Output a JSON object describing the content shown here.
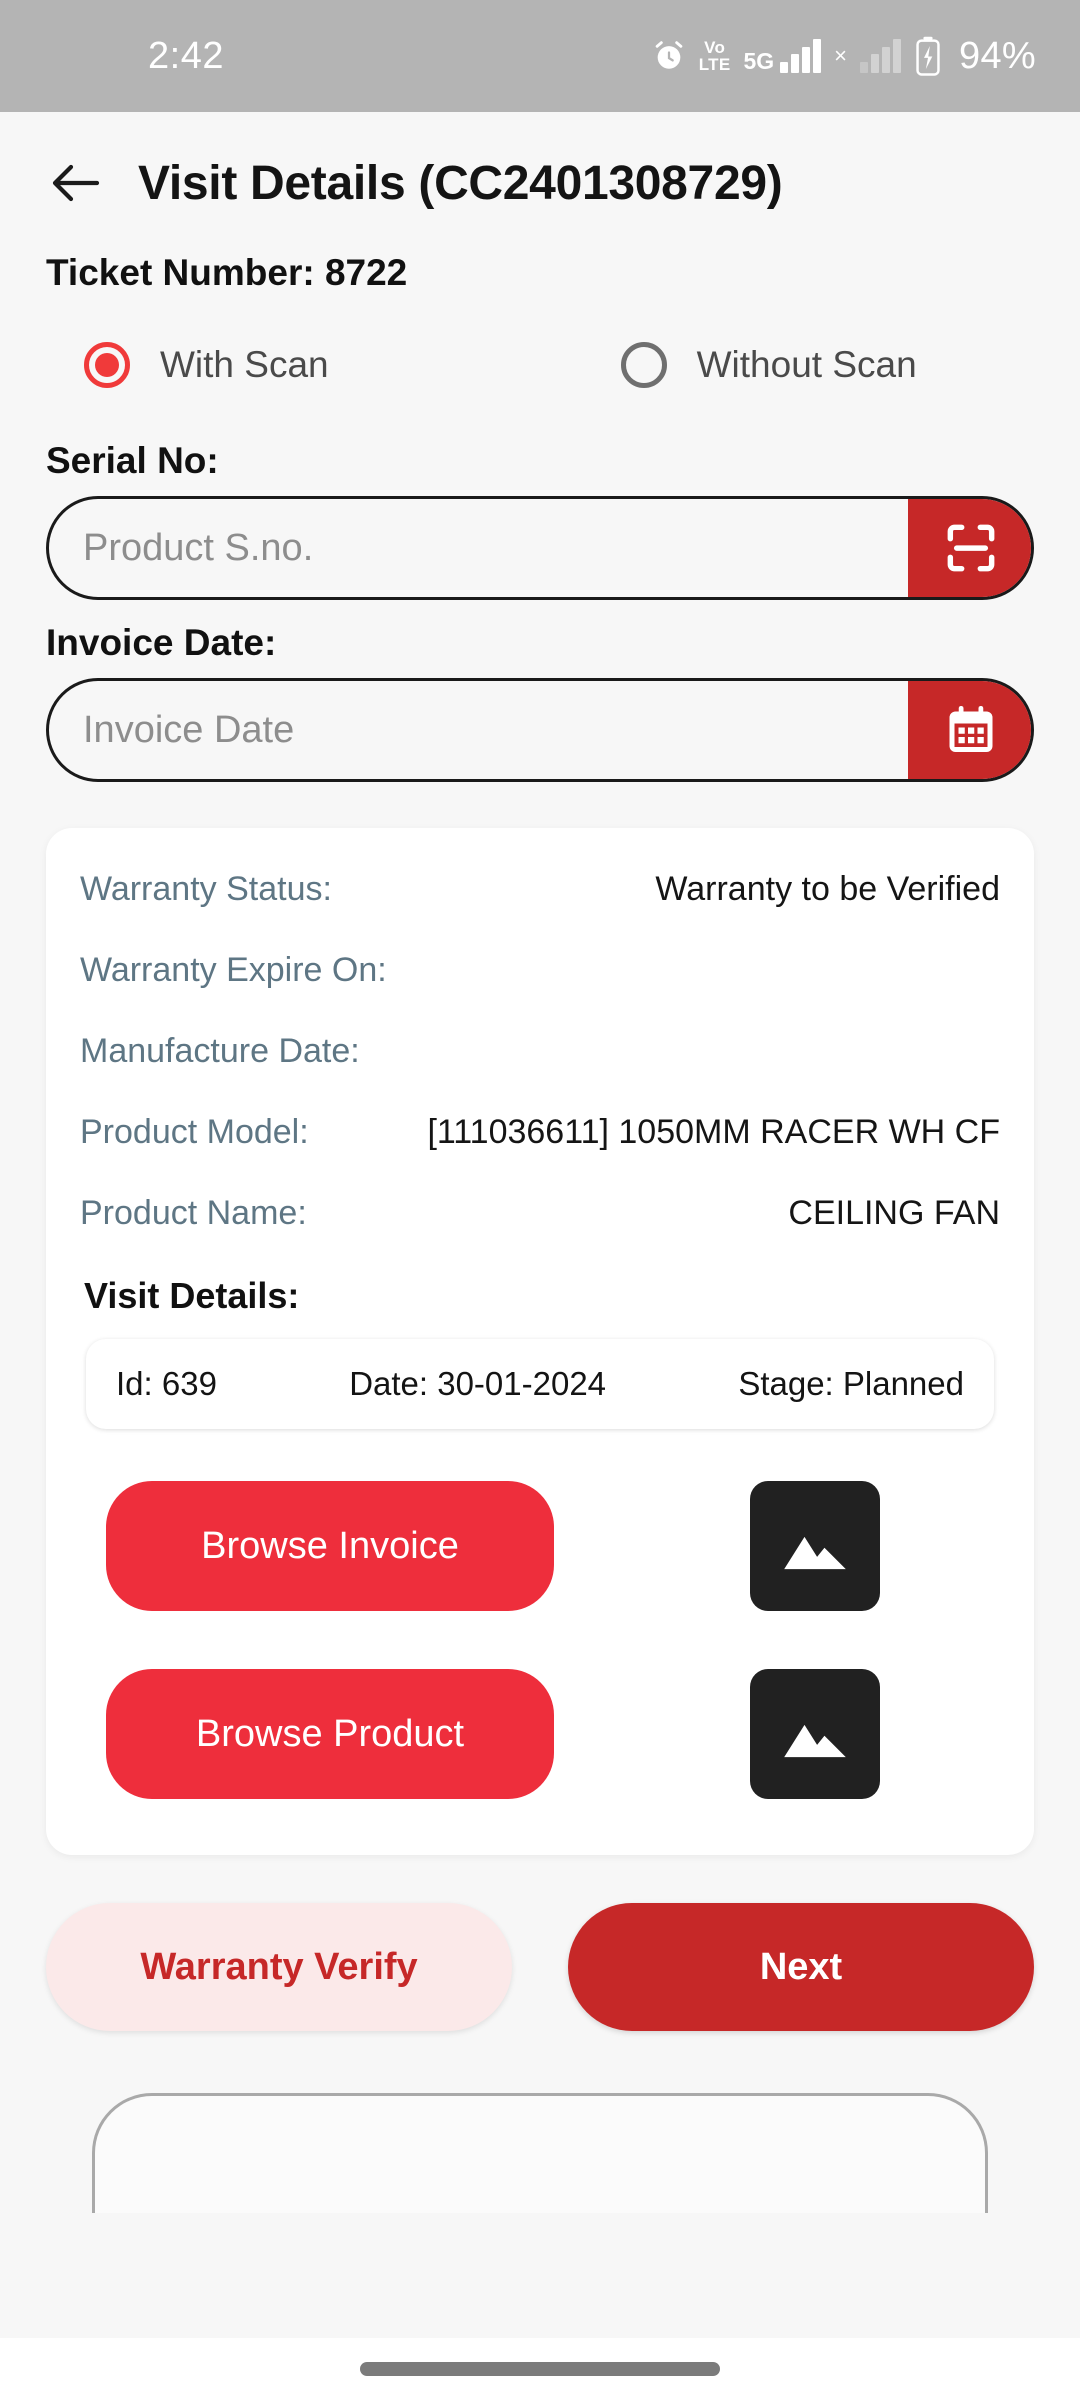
{
  "status_bar": {
    "time": "2:42",
    "battery_percent": "94%",
    "volte_line1": "Vo",
    "volte_line2": "LTE",
    "network_type": "5G",
    "sim_x": "×",
    "icons": [
      "alarm-icon",
      "volte-icon",
      "signal-5g-icon",
      "sim-missing-icon",
      "signal-secondary-icon",
      "battery-charging-icon"
    ]
  },
  "header": {
    "back_icon": "arrow-left-icon",
    "title": "Visit Details (CC2401308729)",
    "ticket_line": "Ticket Number: 8722"
  },
  "scan_mode": {
    "selected": "With Scan",
    "options": [
      {
        "label": "With Scan",
        "selected": true
      },
      {
        "label": "Without Scan",
        "selected": false
      }
    ]
  },
  "serial_field": {
    "label": "Serial No:",
    "placeholder": "Product S.no.",
    "value": "",
    "action_icon": "barcode-scan-icon"
  },
  "invoice_date_field": {
    "label": "Invoice Date:",
    "placeholder": "Invoice Date",
    "value": "",
    "action_icon": "calendar-icon"
  },
  "info_card": {
    "rows": [
      {
        "key": "Warranty Status:",
        "value": "Warranty to be Verified"
      },
      {
        "key": "Warranty Expire On:",
        "value": ""
      },
      {
        "key": "Manufacture Date:",
        "value": ""
      },
      {
        "key": "Product Model:",
        "value": "[111036611] 1050MM RACER WH CF"
      },
      {
        "key": "Product Name:",
        "value": "CEILING FAN"
      }
    ],
    "visit_heading": "Visit Details:",
    "visit_row": {
      "id": "Id: 639",
      "date": "Date: 30-01-2024",
      "stage": "Stage: Planned"
    },
    "browse_invoice": {
      "label": "Browse Invoice",
      "thumb_icon": "image-placeholder-icon"
    },
    "browse_product": {
      "label": "Browse Product",
      "thumb_icon": "image-placeholder-icon"
    }
  },
  "actions": {
    "warranty_verify_label": "Warranty Verify",
    "next_label": "Next"
  },
  "colors": {
    "primary_red": "#c62828",
    "accent_red": "#ee2e3c",
    "radio_red": "#f03a3a",
    "soft_red_bg": "#fbe9e9",
    "label_slate": "#5e7684",
    "page_bg": "#f7f7f7",
    "card_bg": "#ffffff",
    "status_bar_bg": "#b4b4b4",
    "thumb_bg": "#212121"
  }
}
